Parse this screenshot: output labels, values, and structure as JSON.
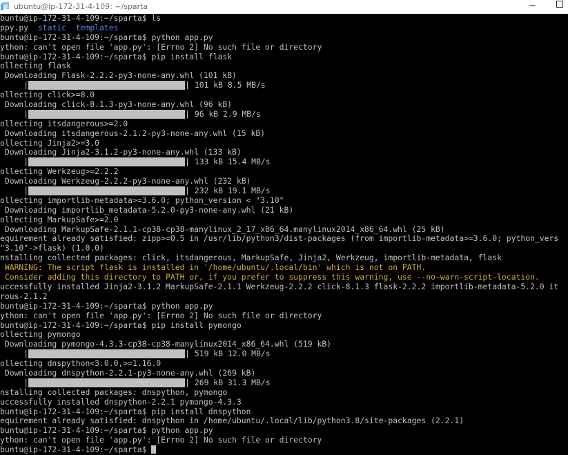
{
  "window": {
    "title": "ubuntu@ip-172-31-4-109: ~/sparta",
    "icon": "terminal-app-icon",
    "controls": [
      "minimize-icon",
      "maximize-icon"
    ]
  },
  "colors": {
    "background": "#000000",
    "text": "#c0c0c0",
    "directory": "#5d8ce6",
    "warning": "#d2a73a",
    "progress": "#c0c0c0"
  },
  "terminal": {
    "lines": [
      {
        "kind": "text",
        "text": "buntu@ip-172-31-4-109:~/sparta$ ls"
      },
      {
        "kind": "ls",
        "parts": [
          {
            "text": "ppy.py",
            "cls": ""
          },
          {
            "text": "  ",
            "cls": ""
          },
          {
            "text": "static",
            "cls": "dir"
          },
          {
            "text": "  ",
            "cls": ""
          },
          {
            "text": "templates",
            "cls": "dir"
          }
        ]
      },
      {
        "kind": "text",
        "text": "buntu@ip-172-31-4-109:~/sparta$ python app.py"
      },
      {
        "kind": "text",
        "text": "ython: can't open file 'app.py': [Errno 2] No such file or directory"
      },
      {
        "kind": "text",
        "text": "buntu@ip-172-31-4-109:~/sparta$ pip install flask"
      },
      {
        "kind": "text",
        "text": "ollecting flask"
      },
      {
        "kind": "text",
        "text": " Downloading Flask-2.2.2-py3-none-any.whl (101 kB)"
      },
      {
        "kind": "progress",
        "fraction": 1.0,
        "prefix": "     |",
        "suffix": "| 101 kB 8.5 MB/s"
      },
      {
        "kind": "text",
        "text": "ollecting click>=8.0"
      },
      {
        "kind": "text",
        "text": " Downloading click-8.1.3-py3-none-any.whl (96 kB)"
      },
      {
        "kind": "progress",
        "fraction": 1.0,
        "prefix": "     |",
        "suffix": "| 96 kB 2.9 MB/s"
      },
      {
        "kind": "text",
        "text": "ollecting itsdangerous>=2.0"
      },
      {
        "kind": "text",
        "text": " Downloading itsdangerous-2.1.2-py3-none-any.whl (15 kB)"
      },
      {
        "kind": "text",
        "text": "ollecting Jinja2>=3.0"
      },
      {
        "kind": "text",
        "text": " Downloading Jinja2-3.1.2-py3-none-any.whl (133 kB)"
      },
      {
        "kind": "progress",
        "fraction": 1.0,
        "prefix": "     |",
        "suffix": "| 133 kB 15.4 MB/s"
      },
      {
        "kind": "text",
        "text": "ollecting Werkzeug>=2.2.2"
      },
      {
        "kind": "text",
        "text": " Downloading Werkzeug-2.2.2-py3-none-any.whl (232 kB)"
      },
      {
        "kind": "progress",
        "fraction": 1.0,
        "prefix": "     |",
        "suffix": "| 232 kB 19.1 MB/s"
      },
      {
        "kind": "text",
        "text": "ollecting importlib-metadata>=3.6.0; python_version < \"3.10\""
      },
      {
        "kind": "text",
        "text": " Downloading importlib_metadata-5.2.0-py3-none-any.whl (21 kB)"
      },
      {
        "kind": "text",
        "text": "ollecting MarkupSafe>=2.0"
      },
      {
        "kind": "text",
        "text": " Downloading MarkupSafe-2.1.1-cp38-cp38-manylinux_2_17_x86_64.manylinux2014_x86_64.whl (25 kB)"
      },
      {
        "kind": "text",
        "text": "equirement already satisfied: zipp>=0.5 in /usr/lib/python3/dist-packages (from importlib-metadata>=3.6.0; python_vers"
      },
      {
        "kind": "text",
        "text": "\"3.10\"->flask) (1.0.0)"
      },
      {
        "kind": "text",
        "text": "nstalling collected packages: click, itsdangerous, MarkupSafe, Jinja2, Werkzeug, importlib-metadata, flask"
      },
      {
        "kind": "warn",
        "text": " WARNING: The script flask is installed in '/home/ubuntu/.local/bin' which is not on PATH."
      },
      {
        "kind": "warn",
        "text": " Consider adding this directory to PATH or, if you prefer to suppress this warning, use --no-warn-script-location."
      },
      {
        "kind": "text",
        "text": "uccessfully installed Jinja2-3.1.2 MarkupSafe-2.1.1 Werkzeug-2.2.2 click-8.1.3 flask-2.2.2 importlib-metadata-5.2.0 it"
      },
      {
        "kind": "text",
        "text": "rous-2.1.2"
      },
      {
        "kind": "text",
        "text": "buntu@ip-172-31-4-109:~/sparta$ python app.py"
      },
      {
        "kind": "text",
        "text": "ython: can't open file 'app.py': [Errno 2] No such file or directory"
      },
      {
        "kind": "text",
        "text": "buntu@ip-172-31-4-109:~/sparta$ pip install pymongo"
      },
      {
        "kind": "text",
        "text": "ollecting pymongo"
      },
      {
        "kind": "text",
        "text": " Downloading pymongo-4.3.3-cp38-cp38-manylinux2014_x86_64.whl (519 kB)"
      },
      {
        "kind": "progress",
        "fraction": 1.0,
        "prefix": "     |",
        "suffix": "| 519 kB 12.0 MB/s"
      },
      {
        "kind": "text",
        "text": "ollecting dnspython<3.0.0,>=1.16.0"
      },
      {
        "kind": "text",
        "text": " Downloading dnspython-2.2.1-py3-none-any.whl (269 kB)"
      },
      {
        "kind": "progress",
        "fraction": 1.0,
        "prefix": "     |",
        "suffix": "| 269 kB 31.3 MB/s"
      },
      {
        "kind": "text",
        "text": "nstalling collected packages: dnspython, pymongo"
      },
      {
        "kind": "text",
        "text": "uccessfully installed dnspython-2.2.1 pymongo-4.3.3"
      },
      {
        "kind": "text",
        "text": "buntu@ip-172-31-4-109:~/sparta$ pip install dnspython"
      },
      {
        "kind": "text",
        "text": "equirement already satisfied: dnspython in /home/ubuntu/.local/lib/python3.8/site-packages (2.2.1)"
      },
      {
        "kind": "text",
        "text": "buntu@ip-172-31-4-109:~/sparta$ python app.py"
      },
      {
        "kind": "text",
        "text": "ython: can't open file 'app.py': [Errno 2] No such file or directory"
      },
      {
        "kind": "prompt",
        "text": "buntu@ip-172-31-4-109:~/sparta$ "
      }
    ]
  }
}
